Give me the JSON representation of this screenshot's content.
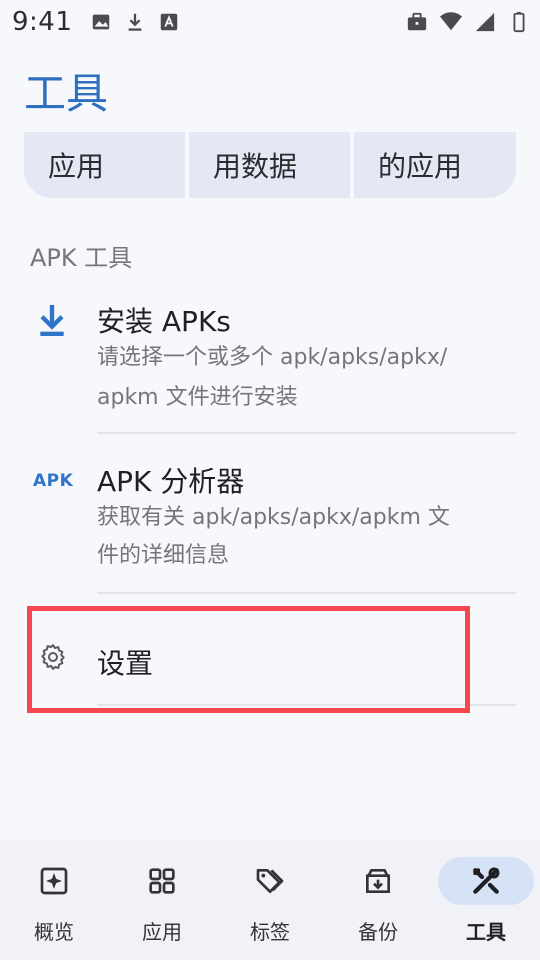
{
  "status_bar": {
    "time": "9:41",
    "icons": [
      "image-icon",
      "download-icon",
      "text-a-icon",
      "briefcase-icon",
      "wifi-icon",
      "signal-icon",
      "battery-icon"
    ]
  },
  "page": {
    "title": "工具"
  },
  "chips": [
    "应用",
    "用数据",
    "的应用"
  ],
  "section": {
    "header": "APK 工具",
    "items": [
      {
        "title": "安装 APKs",
        "subtitle_line1": "请选择一个或多个 apk/apks/apkx/",
        "subtitle_line2": "apkm 文件进行安装",
        "icon": "download-icon"
      },
      {
        "title": "APK 分析器",
        "subtitle_line1": "获取有关 apk/apks/apkx/apkm 文",
        "subtitle_line2": "件的详细信息",
        "icon": "apk-icon",
        "badge": "APK"
      },
      {
        "title": "设置",
        "icon": "gear-icon"
      }
    ]
  },
  "nav": [
    {
      "label": "概览",
      "icon": "sparkle-icon",
      "active": false
    },
    {
      "label": "应用",
      "icon": "grid-icon",
      "active": false
    },
    {
      "label": "标签",
      "icon": "tags-icon",
      "active": false
    },
    {
      "label": "备份",
      "icon": "archive-icon",
      "active": false
    },
    {
      "label": "工具",
      "icon": "tools-icon",
      "active": true
    }
  ],
  "colors": {
    "accent": "#2f6fbf",
    "highlight": "#f4474f",
    "active_pill": "#d6e2f6"
  }
}
